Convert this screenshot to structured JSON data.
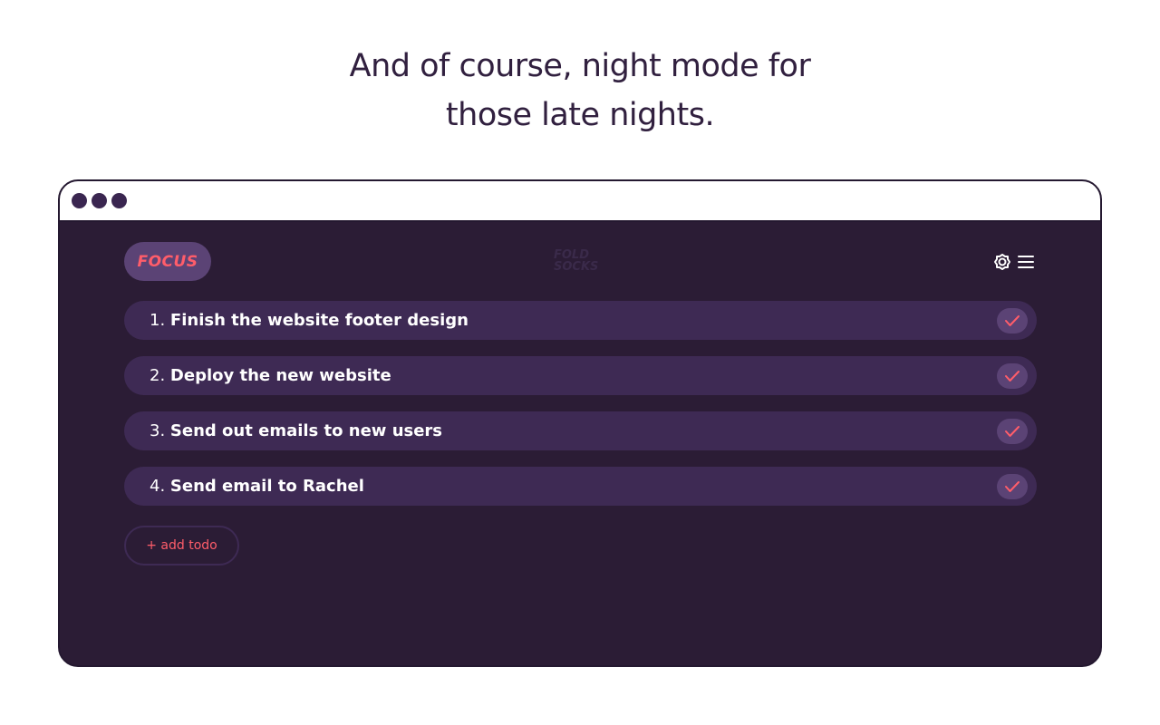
{
  "headline": {
    "line1": "And of course, night mode for",
    "line2": "those late nights."
  },
  "app": {
    "mode_label": "FOCUS",
    "logo": {
      "line1": "FOLD",
      "line2": "SOCKS"
    },
    "icons": {
      "theme": "sun-icon",
      "menu": "menu-icon",
      "check": "check-icon"
    },
    "todos": [
      {
        "number": "1.",
        "text": "Finish the website footer design"
      },
      {
        "number": "2.",
        "text": "Deploy the new website"
      },
      {
        "number": "3.",
        "text": "Send out emails to new users"
      },
      {
        "number": "4.",
        "text": "Send email to Rachel"
      }
    ],
    "add_button": "+ add todo"
  },
  "colors": {
    "background": "#2b1c35",
    "row": "#3e2a54",
    "accent": "#ff5d6a",
    "pill": "#5b4375",
    "headline": "#31203f"
  }
}
